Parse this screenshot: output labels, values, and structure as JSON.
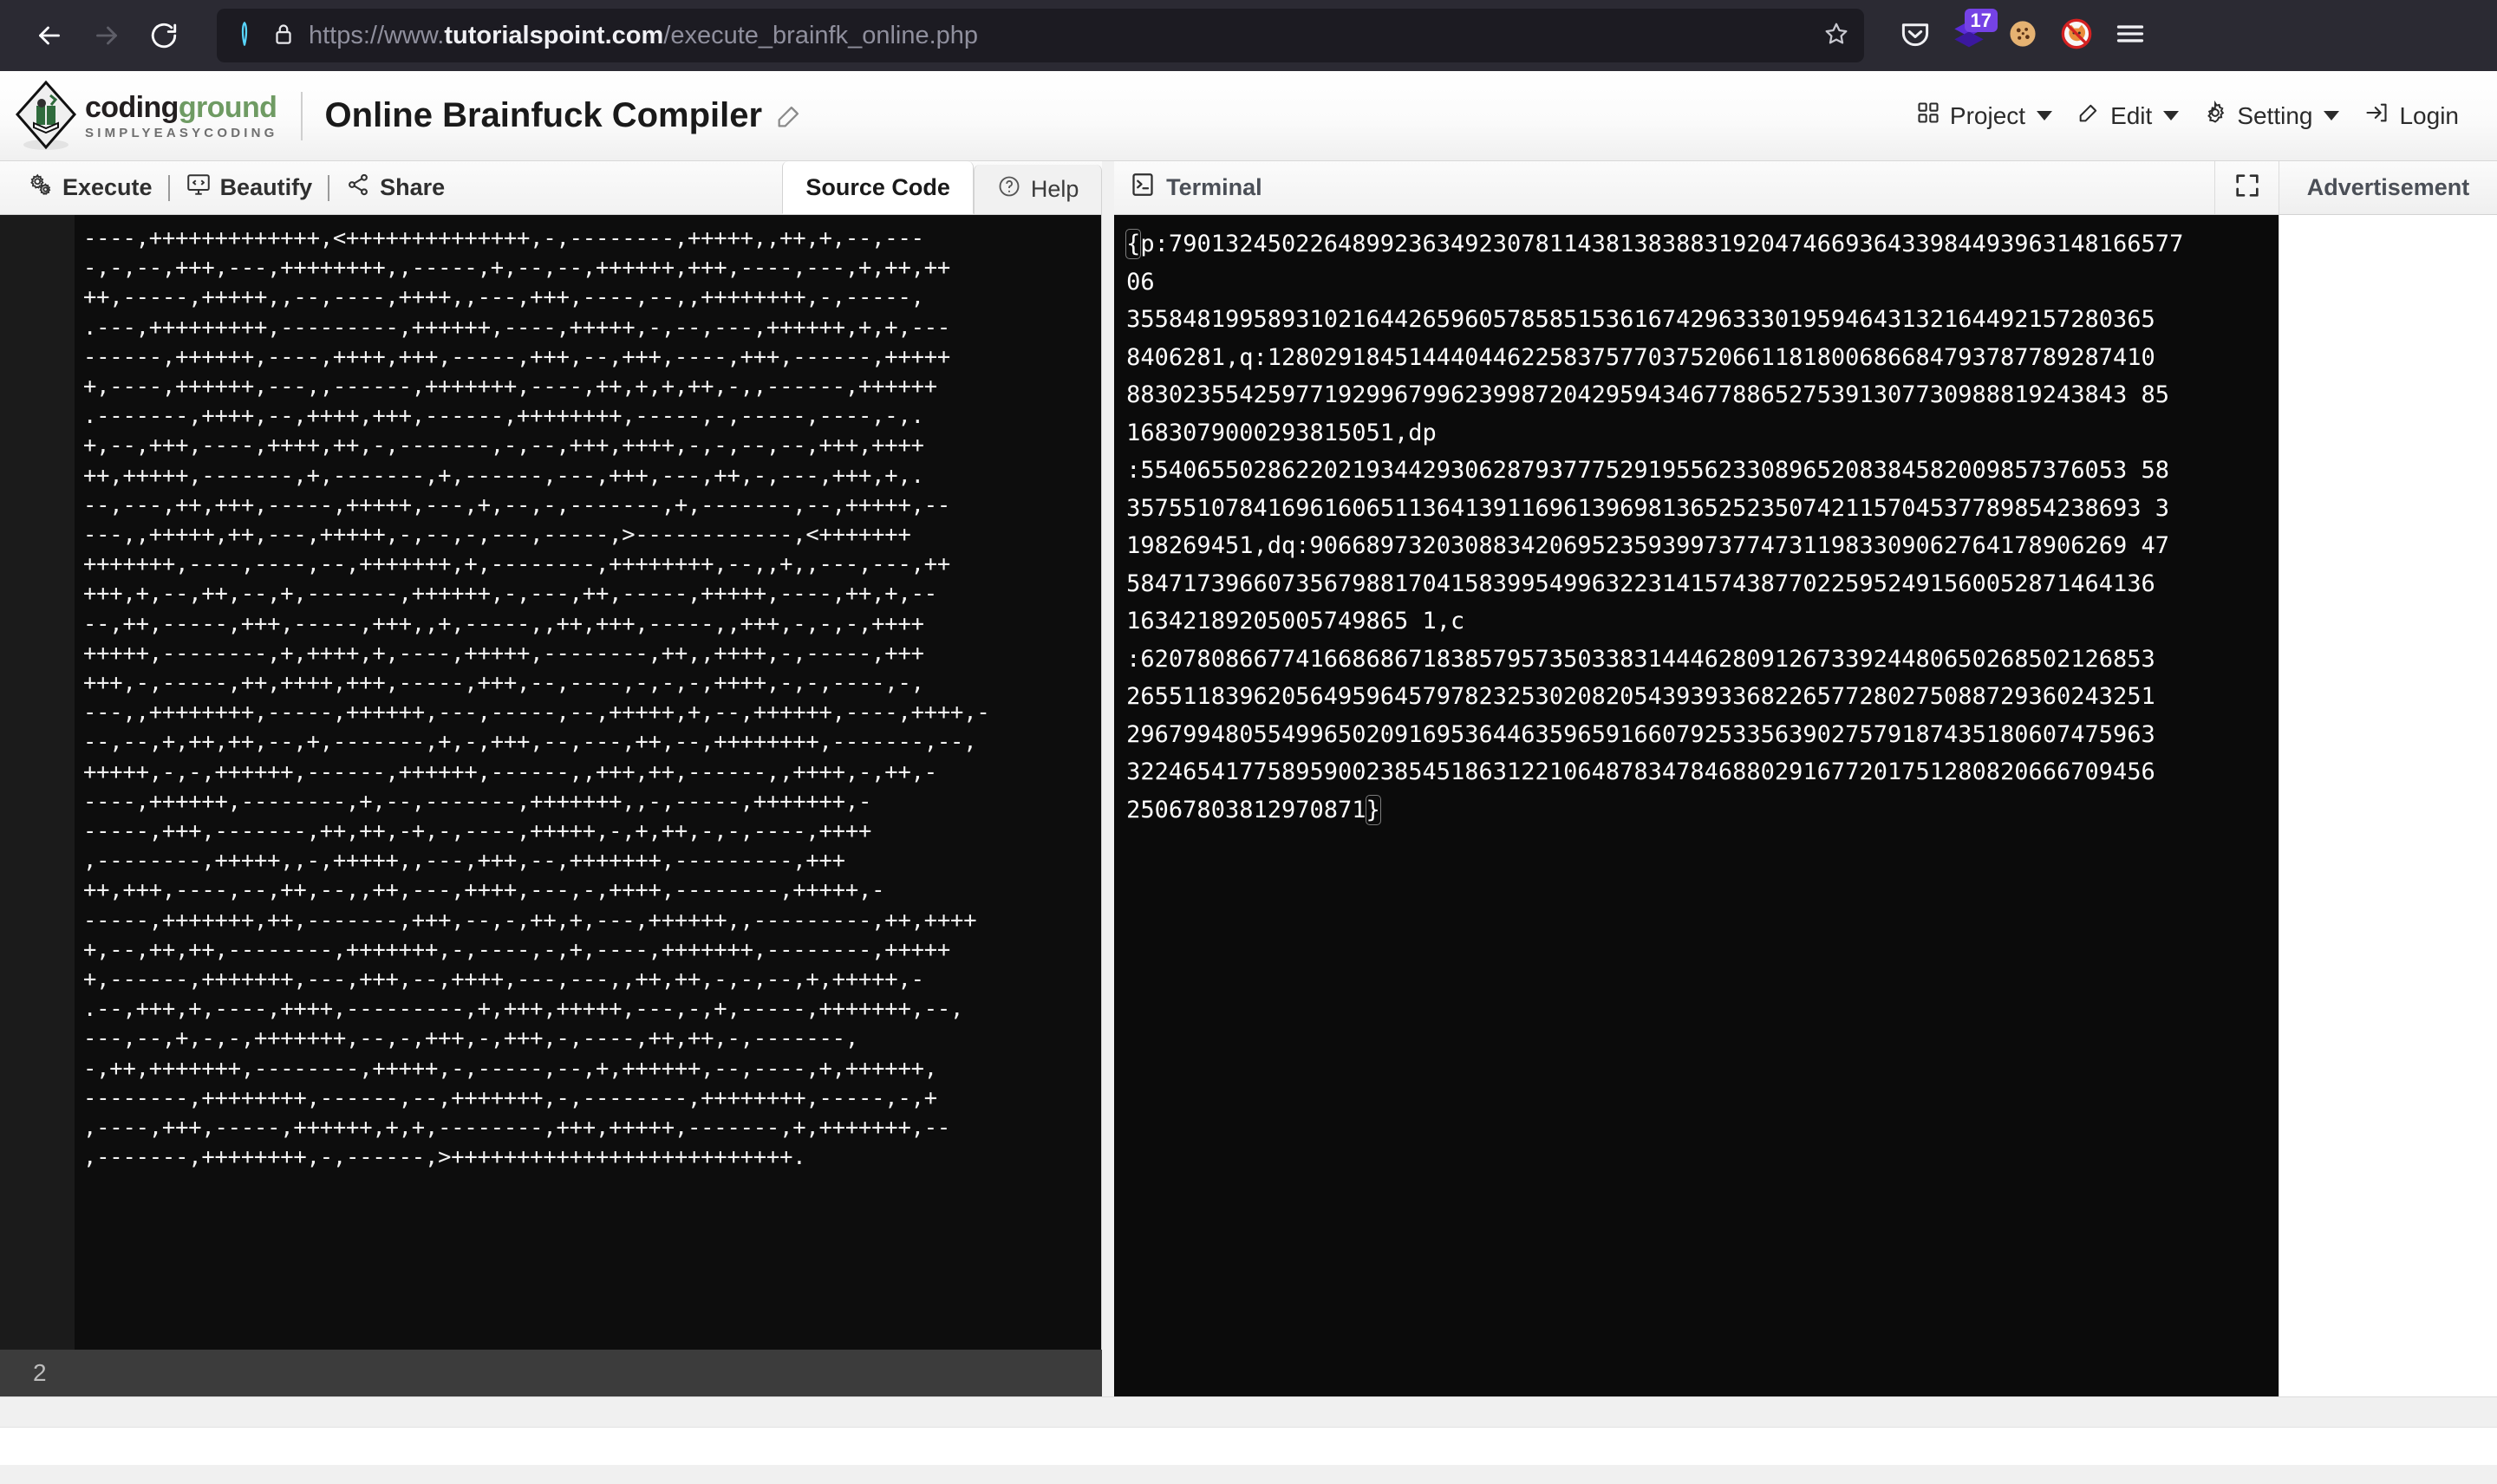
{
  "browser": {
    "back_icon": "back-arrow-icon",
    "forward_icon": "forward-arrow-icon",
    "reload_icon": "reload-icon",
    "shield_icon": "shield-icon",
    "lock_icon": "padlock-icon",
    "url_prefix": "https://www.",
    "url_domain": "tutorialspoint.com",
    "url_path": "/execute_brainfk_online.php",
    "bookmark_icon": "star-icon",
    "pocket_icon": "pocket-icon",
    "extension_icon": "layers-extension-icon",
    "extension_badge": "17",
    "cookie_icon": "cookie-icon",
    "blocked_fox_icon": "no-fox-icon",
    "menu_icon": "hamburger-menu-icon"
  },
  "app_header": {
    "brand_part1": "coding",
    "brand_part2": "ground",
    "brand_tagline": "SIMPLYEASYCODING",
    "page_title": "Online Brainfuck Compiler",
    "title_edit_icon": "edit-pencil-icon",
    "menu": [
      {
        "label": "Project",
        "icon": "grid-icon",
        "has_caret": true
      },
      {
        "label": "Edit",
        "icon": "pencil-square-icon",
        "has_caret": true
      },
      {
        "label": "Setting",
        "icon": "gear-icon",
        "has_caret": true
      },
      {
        "label": "Login",
        "icon": "login-arrow-icon",
        "has_caret": false
      }
    ]
  },
  "editor_toolbar": {
    "actions": [
      {
        "label": "Execute",
        "icon": "gears-icon"
      },
      {
        "label": "Beautify",
        "icon": "code-monitor-icon"
      },
      {
        "label": "Share",
        "icon": "share-nodes-icon"
      }
    ],
    "tabs": [
      {
        "label": "Source Code",
        "active": true,
        "icon": null
      },
      {
        "label": "Help",
        "active": false,
        "icon": "question-circle-icon"
      }
    ]
  },
  "terminal_toolbar": {
    "label": "Terminal",
    "icon": "terminal-prompt-icon",
    "expand_icon": "fullscreen-expand-icon",
    "ad_label": "Advertisement"
  },
  "editor": {
    "status_value": "2",
    "code": "----,+++++++++++++,<++++++++++++++,-,--------,+++++,,++,+,--,---\n-,-,--,+++,---,++++++++,,-----,+,--,--,++++++,+++,----,---,+,++,++\n++,-----,+++++,,--,----,++++,,---,+++,----,--,,++++++++,-,-----,\n.---,+++++++++,---------,++++++,----,+++++,-,--,---,++++++,+,+,---\n------,++++++,----,++++,+++,-----,+++,--,+++,----,+++,------,+++++\n+,----,++++++,---,,------,+++++++,----,++,+,+,++,-,,------,++++++\n.-------,++++,--,++++,+++,------,++++++++,-----,-,-----,----,-,.\n+,--,+++,----,++++,++,-,-------,-,--,+++,++++,-,-,--,--,+++,++++\n++,+++++,-------,+,-------,+,------,---,+++,---,++,-,---,+++,+,.\n--,---,++,+++,-----,+++++,---,+,--,-,-------,+,-------,--,+++++,--\n---,,+++++,++,---,+++++,-,--,-,---,-----,>------------,<+++++++\n+++++++,----,----,--,+++++++,+,--------,++++++++,--,,+,,---,---,++\n+++,+,--,++,--,+,-------,++++++,-,---,++,-----,+++++,----,++,+,--\n--,++,-----,+++,-----,+++,,+,-----,,++,+++,-----,,+++,-,-,-,++++\n+++++,--------,+,++++,+,----,+++++,--------,++,,++++,-,-----,+++\n+++,-,-----,++,++++,+++,-----,+++,--,----,-,-,-,++++,-,-,----,-,\n---,,++++++++,-----,++++++,---,-----,--,+++++,+,--,++++++,----,++++,-\n--,--,+,++,++,--,+,-------,+,-,+++,--,---,++,--,++++++++,-------,--,\n+++++,-,-,++++++,------,++++++,------,,+++,++,------,,++++,-,++,-\n----,++++++,--------,+,--,-------,+++++++,,-,-----,+++++++,-\n-----,+++,-------,++,++,-+,-,----,+++++,-,+,++,-,-,----,++++\n,--------,+++++,,-,+++++,,---,+++,--,+++++++,---------,+++\n++,+++,----,--,++,--,,++,---,++++,---,-,++++,--------,+++++,-\n-----,+++++++,++,-------,+++,--,-,++,+,---,++++++,,---------,++,++++\n+,--,++,++,--------,+++++++,-,----,-,+,----,+++++++,--------,+++++\n+,------,+++++++,---,+++,--,++++,---,---,,++,++,-,-,--,+,+++++,-\n.--,+++,+,----,++++,---------,+,+++,+++++,---,-,+,-----,+++++++,--,\n---,--,+,-,-,+++++++,--,-,+++,-,+++,-,----,++,++,-,-------,\n-,++,+++++++,--------,+++++,-,-----,--,+,++++++,--,----,+,++++++,\n--------,++++++++,------,--,+++++++,-,--------,++++++++,-----,-,+\n,----,+++,-----,++++++,+,+,--------,+++,+++++,-------,+,+++++++,--\n,-------,++++++++,-,------,>++++++++++++++++++++++++++."
  },
  "terminal": {
    "output": "{p:79013245022648992363492307811438138388319204746693643398449396314816657706\n3558481995893102164426596057858515361674296333019594643132164492157280365\n8406281,q:12802918451444044622583757703752066118180068668479378778928741088302355425977192996799623998720429594346778865275391307730988819243843851683079000293815051,dp:554065502862202193442930628793777529195562330896520838458200985737605358357551078416961606511364139116961396981365252350742115704537789854238693319826945    1,dq:906689732030883420695235939973774731198330906276417890626947584717396607356798817041583995499632231415743877022595249156005287146413616342189205005749865    1,c:620780866774166868671838579573503383144462809126733924480650268502126853265511839620564959645797823253020820543939336822657728027508872936024325129679948055499650209169536446359659166079253356390275791874351806074759633224654177589590023854518631221064878347846880291677201751280820666709456250678038129708    71}",
    "lines": [
      "{p:79013245022648992363492307811438138388319204746693643398449396314816657706",
      "3558481995893102164426596057858515361674296333019594643132164492157280365",
      "8406281,q:128029184514440446225837577037520661181800686684793787789287410",
      "88302355425977192996799623998720429594346778865275391307730988819243843 85",
      "1683079000293815051,dp",
      ":5540655028622021934429306287937775291955623308965208384582009857376053 58",
      "357551078416961606511364139116961396981365252350742115704537789854238693 3",
      "198269451,dq:9066897320308834206952359399737747311983309062764178906269 47",
      "5847173966073567988170415839954996322314157438770225952491560052871464136",
      "16342189205005749865 1,c",
      ":620780866774166868671838579573503383144462809126733924480650268502126853",
      "2655118396205649596457978232530208205439393368226577280275088729360243251",
      "2967994805549965020916953644635965916607925335639027579187435180607475963",
      "3224654177589590023854518631221064878347846880291677201751280820666709456",
      "25067803812970871}"
    ],
    "open_brace": "{",
    "close_brace": "}"
  }
}
